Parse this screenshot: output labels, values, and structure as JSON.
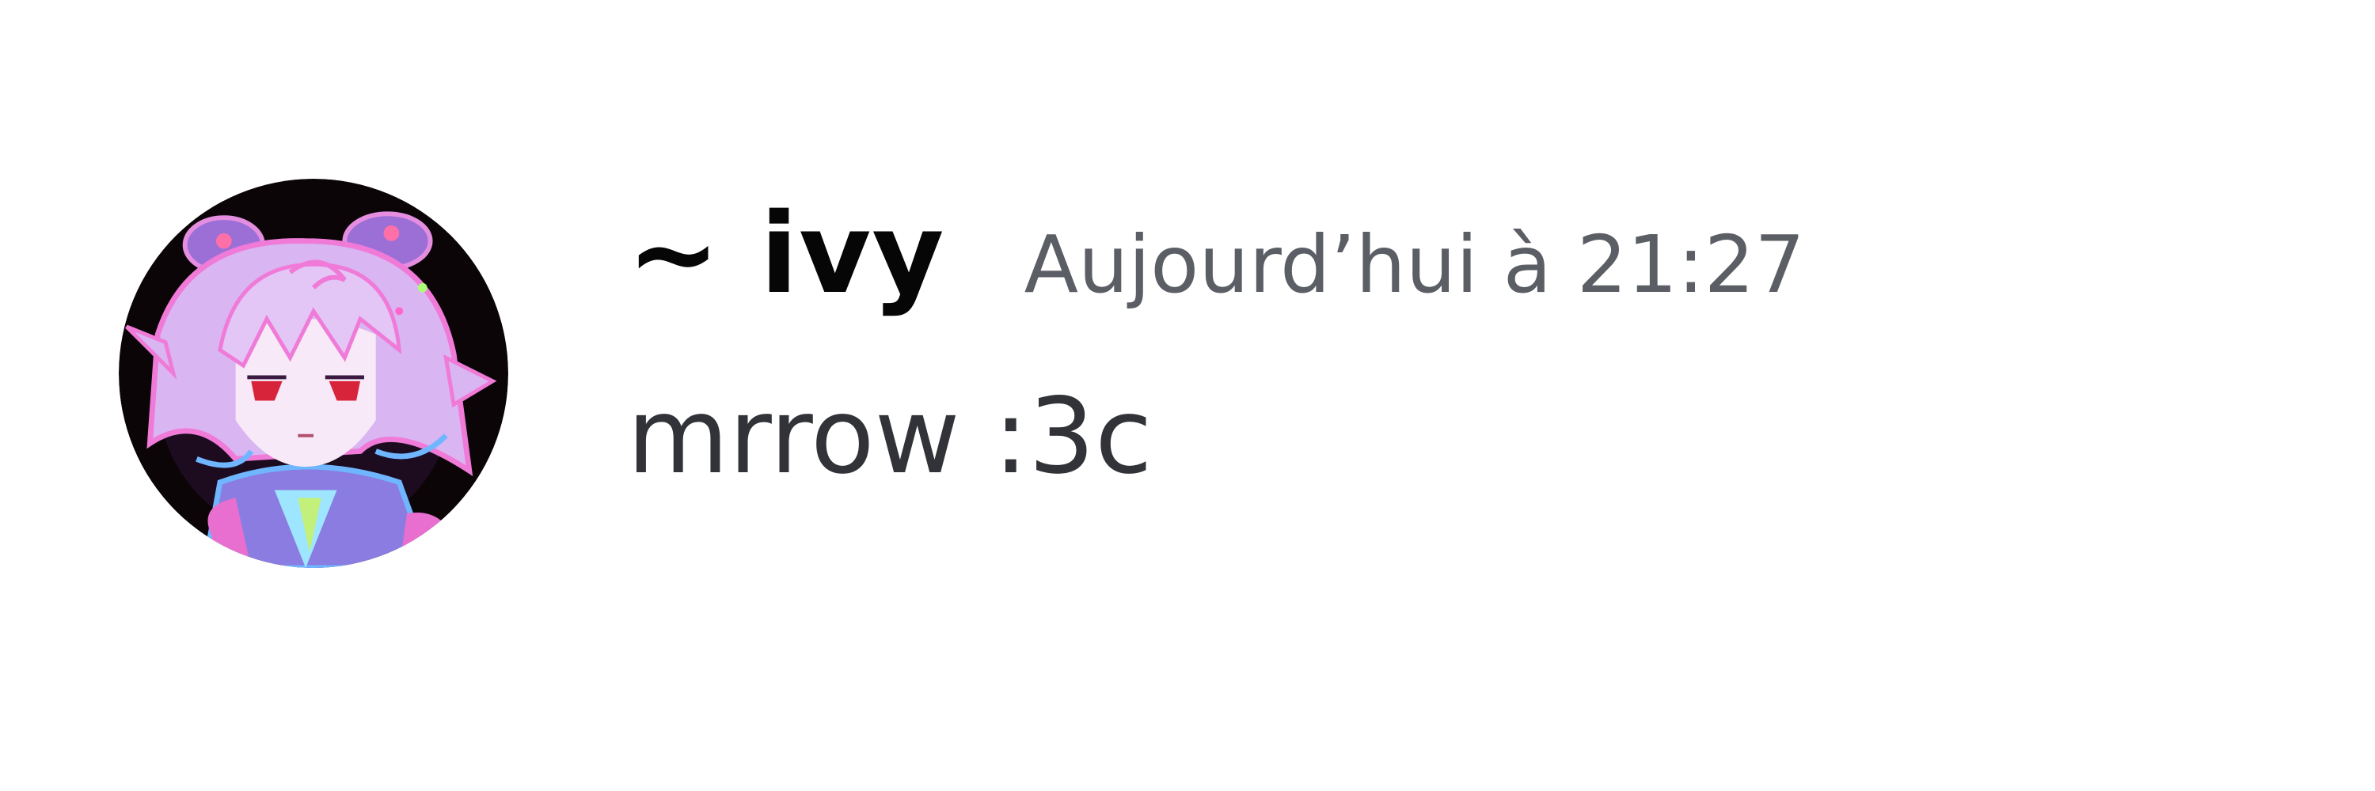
{
  "message": {
    "author": "~ ivy",
    "timestamp": "Aujourd’hui à 21:27",
    "content": "mrrow :3c"
  },
  "colors": {
    "background": "#ffffff",
    "username": "#060607",
    "timestamp": "#5c5e66",
    "content": "#313338",
    "avatar_background": "#0b0508",
    "avatar_hair": "#d9b6f2",
    "avatar_outline": "#f07ad8"
  },
  "icons": {
    "avatar": "anime-character-avatar-icon"
  }
}
